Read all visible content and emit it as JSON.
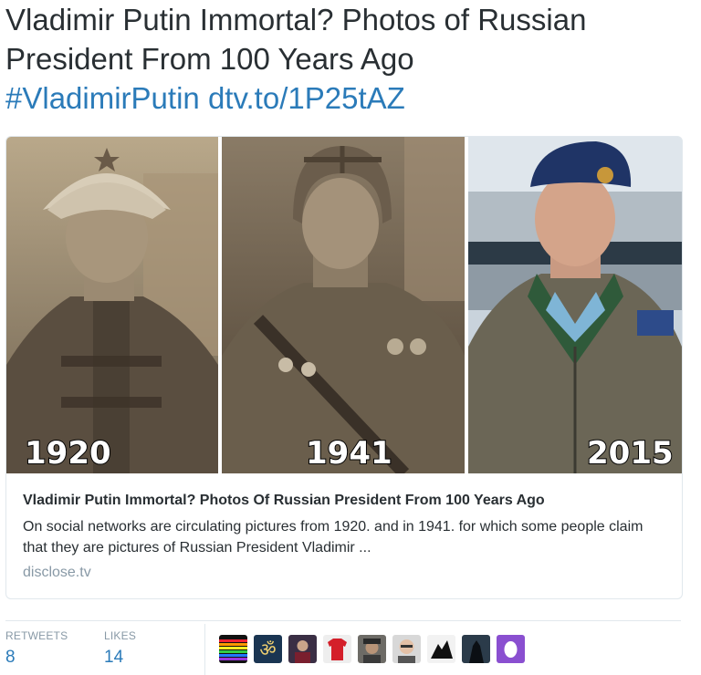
{
  "tweet": {
    "line1": "Vladimir Putin Immortal? Photos of Russian",
    "line2": "President From 100 Years Ago",
    "hashtag": "#VladimirPutin",
    "link": "dtv.to/1P25tAZ"
  },
  "card": {
    "image_labels": [
      "1920",
      "1941",
      "2015"
    ],
    "title": "Vladimir Putin Immortal? Photos Of Russian President From 100 Years Ago",
    "description": "On social networks are circulating pictures from 1920. and in 1941. for which some people claim that they are pictures of Russian President Vladimir ...",
    "domain": "disclose.tv"
  },
  "stats": {
    "retweets_label": "RETWEETS",
    "retweets_count": "8",
    "likes_label": "LIKES",
    "likes_count": "14"
  },
  "avatars": [
    "avatar-rainbow",
    "avatar-om-symbol",
    "avatar-person-dark",
    "avatar-red-shirt",
    "avatar-person-hat",
    "avatar-person-glasses",
    "avatar-silhouette",
    "avatar-dark-figure",
    "avatar-purple-egg"
  ],
  "colors": {
    "link": "#2b7bb9",
    "text": "#292f33",
    "muted": "#8899a6",
    "border": "#e1e8ed"
  }
}
